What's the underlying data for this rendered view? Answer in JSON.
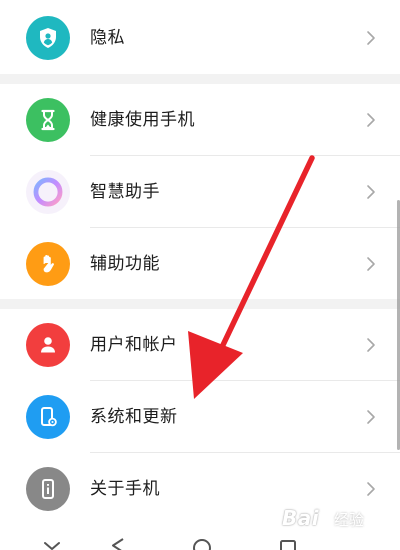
{
  "settings_list": {
    "items": [
      {
        "label": "隐私",
        "icon": "shield-icon",
        "icon_color": "#1fb8c0"
      },
      {
        "label": "健康使用手机",
        "icon": "hourglass-icon",
        "icon_color": "#3cc061"
      },
      {
        "label": "智慧助手",
        "icon": "assistant-ring-icon",
        "icon_color": "#c49cf2"
      },
      {
        "label": "辅助功能",
        "icon": "hand-icon",
        "icon_color": "#ff9c14"
      },
      {
        "label": "用户和帐户",
        "icon": "user-icon",
        "icon_color": "#f23e3e"
      },
      {
        "label": "系统和更新",
        "icon": "phone-settings-icon",
        "icon_color": "#1f9df2"
      },
      {
        "label": "关于手机",
        "icon": "phone-info-icon",
        "icon_color": "#888888"
      }
    ]
  },
  "navigation_bar": {
    "buttons": [
      "collapse-icon",
      "back-icon",
      "home-icon",
      "recents-icon"
    ]
  },
  "annotation": {
    "type": "red-arrow",
    "color": "#e8232a",
    "points_to": "系统和更新"
  },
  "watermark": {
    "text": "Bai",
    "sub": "经验"
  }
}
